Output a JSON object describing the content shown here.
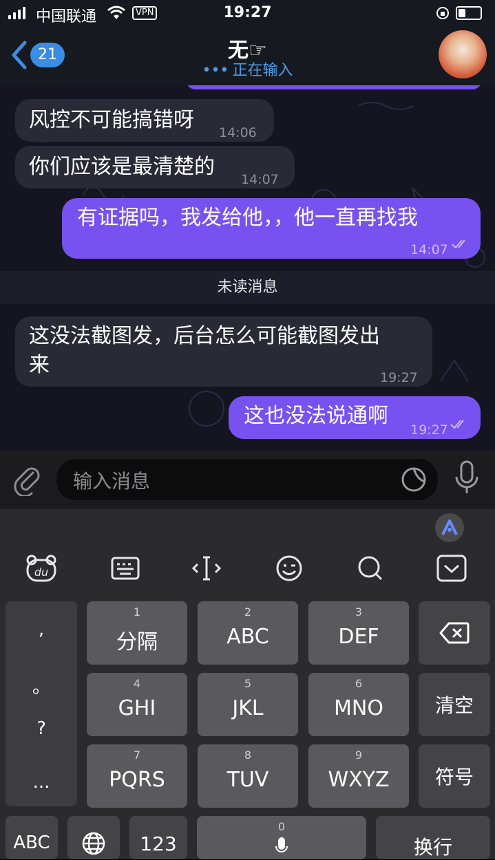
{
  "status": {
    "carrier": "中国联通",
    "vpn": "VPN",
    "time": "19:27"
  },
  "header": {
    "back_count": "21",
    "title": "无☞",
    "subtitle": "正在输入"
  },
  "messages": [
    {
      "dir": "in",
      "text": "风控不可能搞错呀",
      "time": "14:06"
    },
    {
      "dir": "in",
      "text": "你们应该是最清楚的",
      "time": "14:07"
    },
    {
      "dir": "out",
      "text": "有证据吗，我发给他，，他一直再找我",
      "time": "14:07",
      "read": true
    },
    {
      "dir": "in",
      "text_line1": "这没法截图发，后台怎么可能截图发出",
      "text_line2": "来",
      "time": "19:27"
    },
    {
      "dir": "out",
      "text": "这也没法说通啊",
      "time": "19:27",
      "read": true
    }
  ],
  "unread_label": "未读消息",
  "input": {
    "placeholder": "输入消息"
  },
  "keyboard": {
    "side": [
      ",",
      "。",
      "?",
      "..."
    ],
    "keys": [
      {
        "num": "1",
        "label": "分隔"
      },
      {
        "num": "2",
        "label": "ABC"
      },
      {
        "num": "3",
        "label": "DEF"
      },
      {
        "num": "4",
        "label": "GHI"
      },
      {
        "num": "5",
        "label": "JKL"
      },
      {
        "num": "6",
        "label": "MNO"
      },
      {
        "num": "7",
        "label": "PQRS"
      },
      {
        "num": "8",
        "label": "TUV"
      },
      {
        "num": "9",
        "label": "WXYZ"
      }
    ],
    "clear": "清空",
    "symbols": "符号",
    "abc": "ABC",
    "num123": "123",
    "space_num": "0",
    "enter": "换行"
  },
  "colors": {
    "outgoing_bubble": "#7752f0",
    "incoming_bubble": "#2a2a36",
    "accent_blue": "#3b8de3"
  }
}
